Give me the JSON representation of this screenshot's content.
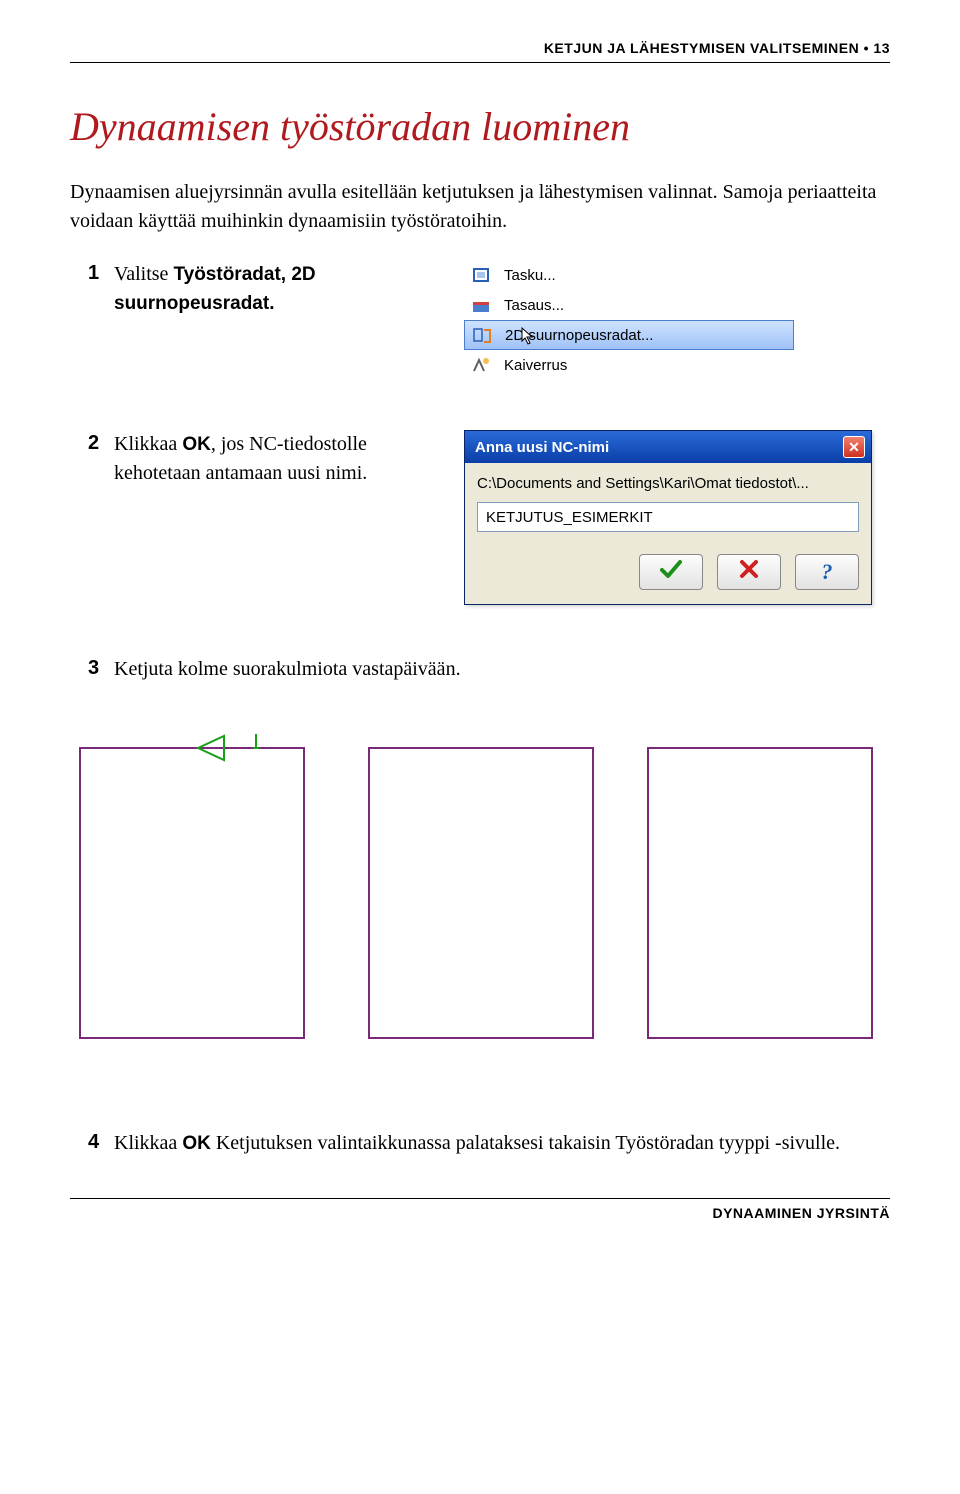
{
  "header": {
    "section": "KETJUN JA LÄHESTYMISEN VALITSEMINEN",
    "bullet": "•",
    "page": "13"
  },
  "title": "Dynaamisen työstöradan luominen",
  "intro": "Dynaamisen aluejyrsinnän avulla esitellään ketjutuksen ja lähestymisen valinnat. Samoja periaatteita voidaan käyttää muihinkin dynaamisiin työstöratoihin.",
  "steps": {
    "s1": {
      "num": "1",
      "text_a": "Valitse ",
      "bold1": "Työstöradat, 2D suurnopeusradat.",
      "text_b": ""
    },
    "s2": {
      "num": "2",
      "text_a": "Klikkaa ",
      "bold1": "OK",
      "text_b": ", jos NC-tiedostolle kehotetaan antamaan uusi nimi."
    },
    "s3": {
      "num": "3",
      "text": "Ketjuta kolme suorakulmiota vastapäivään."
    },
    "s4": {
      "num": "4",
      "text_a": "Klikkaa ",
      "bold1": "OK",
      "text_b": " Ketjutuksen valintaikkunassa palataksesi takaisin Työstöradan tyyppi -sivulle."
    }
  },
  "menu": {
    "items": [
      {
        "label": "Tasku..."
      },
      {
        "label": "Tasaus..."
      },
      {
        "label": "2D suurnopeusradat..."
      },
      {
        "label": "Kaiverrus"
      }
    ]
  },
  "dialog": {
    "title": "Anna uusi NC-nimi",
    "path": "C:\\Documents and Settings\\Kari\\Omat tiedostot\\...",
    "value": "KETJUTUS_ESIMERKIT",
    "ok": "✓",
    "cancel": "✖",
    "help": "?"
  },
  "footer": "DYNAAMINEN JYRSINTÄ"
}
